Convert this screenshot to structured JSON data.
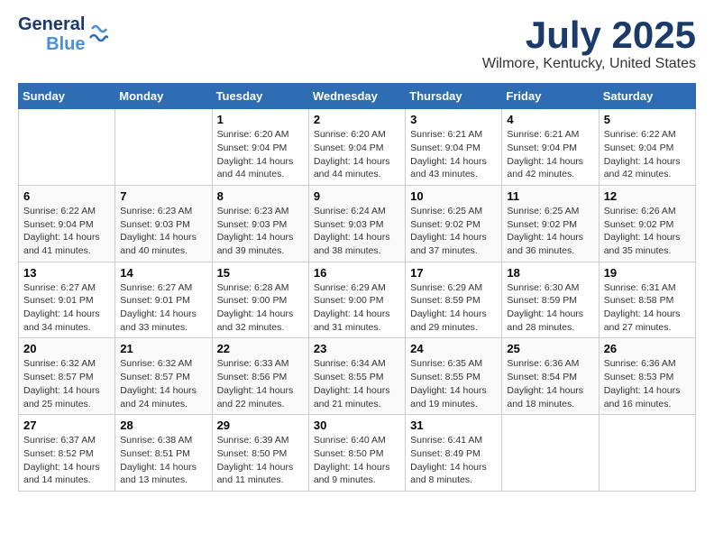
{
  "header": {
    "logo_line1": "General",
    "logo_line2": "Blue",
    "main_title": "July 2025",
    "subtitle": "Wilmore, Kentucky, United States"
  },
  "days_of_week": [
    "Sunday",
    "Monday",
    "Tuesday",
    "Wednesday",
    "Thursday",
    "Friday",
    "Saturday"
  ],
  "weeks": [
    [
      {
        "day": "",
        "info": ""
      },
      {
        "day": "",
        "info": ""
      },
      {
        "day": "1",
        "info": "Sunrise: 6:20 AM\nSunset: 9:04 PM\nDaylight: 14 hours and 44 minutes."
      },
      {
        "day": "2",
        "info": "Sunrise: 6:20 AM\nSunset: 9:04 PM\nDaylight: 14 hours and 44 minutes."
      },
      {
        "day": "3",
        "info": "Sunrise: 6:21 AM\nSunset: 9:04 PM\nDaylight: 14 hours and 43 minutes."
      },
      {
        "day": "4",
        "info": "Sunrise: 6:21 AM\nSunset: 9:04 PM\nDaylight: 14 hours and 42 minutes."
      },
      {
        "day": "5",
        "info": "Sunrise: 6:22 AM\nSunset: 9:04 PM\nDaylight: 14 hours and 42 minutes."
      }
    ],
    [
      {
        "day": "6",
        "info": "Sunrise: 6:22 AM\nSunset: 9:04 PM\nDaylight: 14 hours and 41 minutes."
      },
      {
        "day": "7",
        "info": "Sunrise: 6:23 AM\nSunset: 9:03 PM\nDaylight: 14 hours and 40 minutes."
      },
      {
        "day": "8",
        "info": "Sunrise: 6:23 AM\nSunset: 9:03 PM\nDaylight: 14 hours and 39 minutes."
      },
      {
        "day": "9",
        "info": "Sunrise: 6:24 AM\nSunset: 9:03 PM\nDaylight: 14 hours and 38 minutes."
      },
      {
        "day": "10",
        "info": "Sunrise: 6:25 AM\nSunset: 9:02 PM\nDaylight: 14 hours and 37 minutes."
      },
      {
        "day": "11",
        "info": "Sunrise: 6:25 AM\nSunset: 9:02 PM\nDaylight: 14 hours and 36 minutes."
      },
      {
        "day": "12",
        "info": "Sunrise: 6:26 AM\nSunset: 9:02 PM\nDaylight: 14 hours and 35 minutes."
      }
    ],
    [
      {
        "day": "13",
        "info": "Sunrise: 6:27 AM\nSunset: 9:01 PM\nDaylight: 14 hours and 34 minutes."
      },
      {
        "day": "14",
        "info": "Sunrise: 6:27 AM\nSunset: 9:01 PM\nDaylight: 14 hours and 33 minutes."
      },
      {
        "day": "15",
        "info": "Sunrise: 6:28 AM\nSunset: 9:00 PM\nDaylight: 14 hours and 32 minutes."
      },
      {
        "day": "16",
        "info": "Sunrise: 6:29 AM\nSunset: 9:00 PM\nDaylight: 14 hours and 31 minutes."
      },
      {
        "day": "17",
        "info": "Sunrise: 6:29 AM\nSunset: 8:59 PM\nDaylight: 14 hours and 29 minutes."
      },
      {
        "day": "18",
        "info": "Sunrise: 6:30 AM\nSunset: 8:59 PM\nDaylight: 14 hours and 28 minutes."
      },
      {
        "day": "19",
        "info": "Sunrise: 6:31 AM\nSunset: 8:58 PM\nDaylight: 14 hours and 27 minutes."
      }
    ],
    [
      {
        "day": "20",
        "info": "Sunrise: 6:32 AM\nSunset: 8:57 PM\nDaylight: 14 hours and 25 minutes."
      },
      {
        "day": "21",
        "info": "Sunrise: 6:32 AM\nSunset: 8:57 PM\nDaylight: 14 hours and 24 minutes."
      },
      {
        "day": "22",
        "info": "Sunrise: 6:33 AM\nSunset: 8:56 PM\nDaylight: 14 hours and 22 minutes."
      },
      {
        "day": "23",
        "info": "Sunrise: 6:34 AM\nSunset: 8:55 PM\nDaylight: 14 hours and 21 minutes."
      },
      {
        "day": "24",
        "info": "Sunrise: 6:35 AM\nSunset: 8:55 PM\nDaylight: 14 hours and 19 minutes."
      },
      {
        "day": "25",
        "info": "Sunrise: 6:36 AM\nSunset: 8:54 PM\nDaylight: 14 hours and 18 minutes."
      },
      {
        "day": "26",
        "info": "Sunrise: 6:36 AM\nSunset: 8:53 PM\nDaylight: 14 hours and 16 minutes."
      }
    ],
    [
      {
        "day": "27",
        "info": "Sunrise: 6:37 AM\nSunset: 8:52 PM\nDaylight: 14 hours and 14 minutes."
      },
      {
        "day": "28",
        "info": "Sunrise: 6:38 AM\nSunset: 8:51 PM\nDaylight: 14 hours and 13 minutes."
      },
      {
        "day": "29",
        "info": "Sunrise: 6:39 AM\nSunset: 8:50 PM\nDaylight: 14 hours and 11 minutes."
      },
      {
        "day": "30",
        "info": "Sunrise: 6:40 AM\nSunset: 8:50 PM\nDaylight: 14 hours and 9 minutes."
      },
      {
        "day": "31",
        "info": "Sunrise: 6:41 AM\nSunset: 8:49 PM\nDaylight: 14 hours and 8 minutes."
      },
      {
        "day": "",
        "info": ""
      },
      {
        "day": "",
        "info": ""
      }
    ]
  ]
}
